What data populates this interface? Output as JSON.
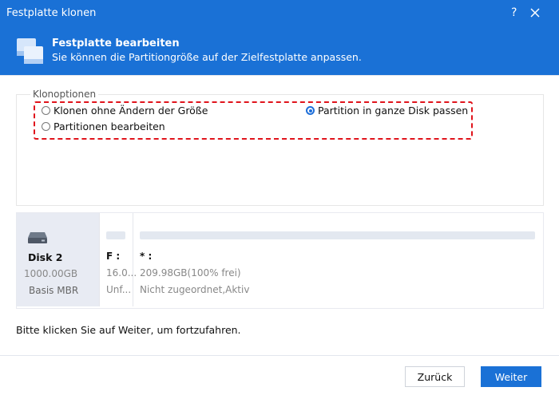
{
  "window": {
    "title": "Festplatte klonen",
    "help": "?"
  },
  "header": {
    "title": "Festplatte bearbeiten",
    "subtitle": "Sie können die Partitiongröße auf der Zielfestplatte anpassen."
  },
  "options": {
    "group_label": "Klonoptionen",
    "items": [
      {
        "label": "Klonen ohne Ändern der Größe",
        "selected": false
      },
      {
        "label": "Partition in ganze Disk passen",
        "selected": true
      },
      {
        "label": "Partitionen bearbeiten",
        "selected": false
      }
    ]
  },
  "disk": {
    "name": "Disk 2",
    "size": "1000.00GB",
    "type": "Basis MBR",
    "partitions": [
      {
        "label": "F :",
        "size": "16.0...",
        "fs": "Unf..."
      },
      {
        "label": "* :",
        "size": "209.98GB(100% frei)",
        "fs": "Nicht zugeordnet,Aktiv"
      }
    ]
  },
  "hint": "Bitte klicken Sie auf Weiter, um fortzufahren.",
  "buttons": {
    "back": "Zurück",
    "next": "Weiter"
  },
  "colors": {
    "accent": "#1a71d6",
    "highlight": "#e0141c",
    "disk_panel": "#e8ebf3"
  }
}
